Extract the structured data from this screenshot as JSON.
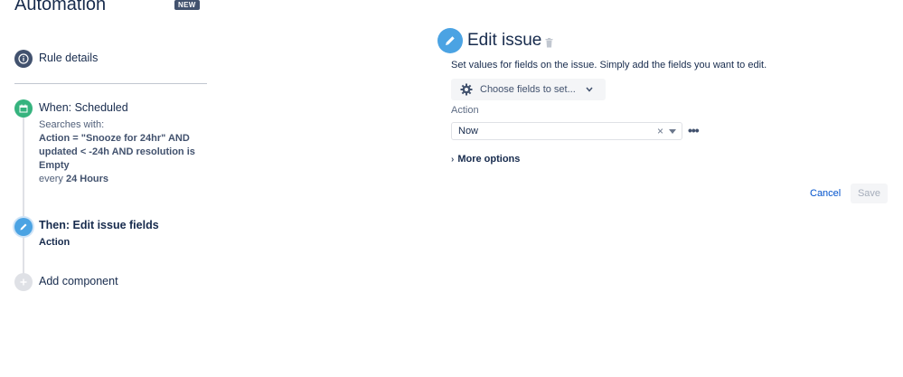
{
  "app": {
    "title": "Automation",
    "badge": "NEW"
  },
  "sidebar": {
    "rule_details": "Rule details",
    "trigger": {
      "title": "When: Scheduled",
      "searches_with": "Searches with:",
      "query": "Action = \"Snooze for 24hr\" AND updated < -24h AND resolution is Empty",
      "every_prefix": "every",
      "every_value": "24 Hours"
    },
    "action": {
      "title": "Then: Edit issue fields",
      "subtitle": "Action"
    },
    "add_component": "Add component"
  },
  "editor": {
    "title": "Edit issue",
    "description": "Set values for fields on the issue. Simply add the fields you want to edit.",
    "choose_fields": "Choose fields to set...",
    "field": {
      "label": "Action",
      "value": "Now",
      "clear": "×"
    },
    "more_options": "More options",
    "cancel": "Cancel",
    "save": "Save"
  },
  "colors": {
    "trigger": "#36b37e",
    "action": "#4ba3e3",
    "link": "#0052cc",
    "neutral": "#42526e"
  },
  "icons": {
    "rule_details": "info-icon",
    "trigger": "calendar-icon",
    "action": "pencil-icon",
    "add": "plus-icon",
    "delete": "trash-icon",
    "choose_fields": "gear-icon"
  }
}
